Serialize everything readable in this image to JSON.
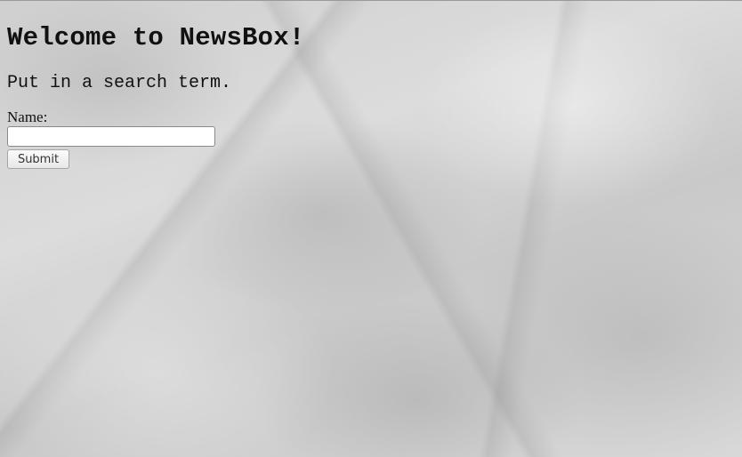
{
  "page": {
    "heading": "Welcome to NewsBox!",
    "subtitle": "Put in a search term."
  },
  "form": {
    "name_label": "Name:",
    "name_value": "",
    "submit_label": "Submit"
  },
  "colors": {
    "background": "#d3d3d3",
    "text": "#111111"
  }
}
